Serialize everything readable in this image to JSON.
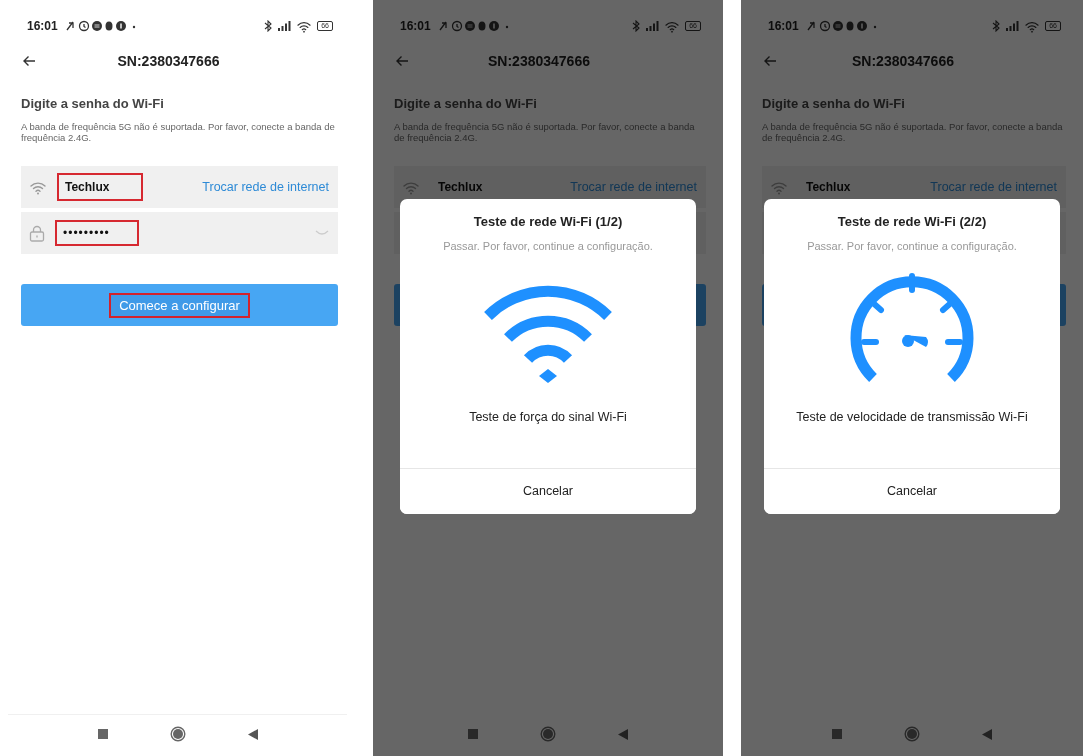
{
  "screens": [
    {
      "status_bar": {
        "time": "16:01",
        "battery": "66"
      },
      "header": {
        "title": "SN:2380347666"
      },
      "heading": "Digite a senha do Wi-Fi",
      "note": "A banda de frequência 5G não é suportada. Por favor, conecte a banda de frequência 2.4G.",
      "network": {
        "name": "Techlux",
        "highlighted": true,
        "link": "Trocar rede de internet"
      },
      "password": {
        "value": "•••••••••",
        "highlighted": true
      },
      "start_button": {
        "label": "Comece a configurar",
        "highlighted": true
      }
    },
    {
      "status_bar": {
        "time": "16:01",
        "battery": "66"
      },
      "header": {
        "title": "SN:2380347666"
      },
      "heading": "Digite a senha do Wi-Fi",
      "note": "A banda de frequência 5G não é suportada. Por favor, conecte a banda de frequência 2.4G.",
      "network": {
        "name": "Techlux",
        "highlighted": false,
        "link": "Trocar rede de internet"
      },
      "dialog": {
        "title": "Teste de rede Wi-Fi (1/2)",
        "message": "Passar. Por favor, continue a configuração.",
        "kind": "wifi",
        "caption": "Teste de força do sinal Wi-Fi",
        "cancel": "Cancelar"
      }
    },
    {
      "status_bar": {
        "time": "16:01",
        "battery": "66"
      },
      "header": {
        "title": "SN:2380347666"
      },
      "heading": "Digite a senha do Wi-Fi",
      "note": "A banda de frequência 5G não é suportada. Por favor, conecte a banda de frequência 2.4G.",
      "network": {
        "name": "Techlux",
        "highlighted": false,
        "link": "Trocar rede de internet"
      },
      "dialog": {
        "title": "Teste de rede Wi-Fi (2/2)",
        "message": "Passar. Por favor, continue a configuração.",
        "kind": "speed",
        "caption": "Teste de velocidade de transmissão Wi-Fi",
        "cancel": "Cancelar"
      }
    }
  ]
}
